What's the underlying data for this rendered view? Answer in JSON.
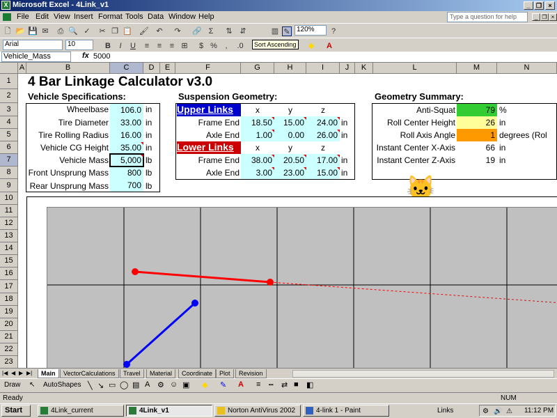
{
  "window": {
    "title": "Microsoft Excel - 4Link_v1"
  },
  "menu": [
    "File",
    "Edit",
    "View",
    "Insert",
    "Format",
    "Tools",
    "Data",
    "Window",
    "Help"
  ],
  "help_placeholder": "Type a question for help",
  "toolbar": {
    "zoom": "120%",
    "tooltip": "Sort Ascending",
    "font_name": "Arial",
    "font_size": "10"
  },
  "formula_bar": {
    "name_box": "Vehicle_Mass",
    "fx": "fx",
    "content": "5000"
  },
  "columns": [
    "A",
    "B",
    "C",
    "D",
    "E",
    "F",
    "G",
    "H",
    "I",
    "J",
    "K",
    "L",
    "M",
    "N"
  ],
  "rows": [
    "1",
    "2",
    "3",
    "4",
    "5",
    "6",
    "7",
    "8",
    "9",
    "10",
    "11",
    "12",
    "13",
    "14",
    "15",
    "16",
    "17",
    "18",
    "19",
    "20",
    "21",
    "22",
    "23"
  ],
  "sheet": {
    "title": "4 Bar Linkage Calculator v3.0",
    "vehicle": {
      "heading": "Vehicle Specifications:",
      "rows": [
        {
          "label": "Wheelbase",
          "value": "106.0",
          "unit": "in"
        },
        {
          "label": "Tire Diameter",
          "value": "33.00",
          "unit": "in"
        },
        {
          "label": "Tire Rolling Radius",
          "value": "16.00",
          "unit": "in"
        },
        {
          "label": "Vehicle CG Height",
          "value": "35.00",
          "unit": "in"
        },
        {
          "label": "Vehicle Mass",
          "value": "5,000",
          "unit": "lb"
        },
        {
          "label": "Front Unsprung Mass",
          "value": "800",
          "unit": "lb"
        },
        {
          "label": "Rear Unsprung Mass",
          "value": "700",
          "unit": "lb"
        }
      ]
    },
    "suspension": {
      "heading": "Suspension Geometry:",
      "cols": [
        "x",
        "y",
        "z"
      ],
      "upper": {
        "title": "Upper Links",
        "color": "#0000cc",
        "rows": [
          {
            "label": "Frame End",
            "x": "18.50",
            "y": "15.00",
            "z": "24.00",
            "unit": "in"
          },
          {
            "label": "Axle End",
            "x": "1.00",
            "y": "0.00",
            "z": "26.00",
            "unit": "in"
          }
        ]
      },
      "lower": {
        "title": "Lower Links",
        "color": "#cc0000",
        "rows": [
          {
            "label": "Frame End",
            "x": "38.00",
            "y": "20.50",
            "z": "17.00",
            "unit": "in"
          },
          {
            "label": "Axle End",
            "x": "3.00",
            "y": "23.00",
            "z": "15.00",
            "unit": "in"
          }
        ]
      }
    },
    "summary": {
      "heading": "Geometry Summary:",
      "rows": [
        {
          "label": "Anti-Squat",
          "value": "79",
          "unit": "%",
          "color": "#33cc33"
        },
        {
          "label": "Roll Center Height",
          "value": "26",
          "unit": "in",
          "color": "#ffff99"
        },
        {
          "label": "Roll Axis Angle",
          "value": "1",
          "unit": "degrees (Rol",
          "color": "#ff9900"
        },
        {
          "label": "Instant Center X-Axis",
          "value": "66",
          "unit": "in",
          "color": "#ffffff"
        },
        {
          "label": "Instant Center Z-Axis",
          "value": "19",
          "unit": "in",
          "color": "#ffffff"
        }
      ]
    }
  },
  "colors": {
    "upper_link": "#0000ff",
    "lower_link": "#ff0000",
    "plot_bg": "#c0c0c0",
    "input_cell": "#ccffff"
  },
  "tabs": [
    "Main",
    "VectorCalculations",
    "Travel",
    "Material",
    "Coordinate",
    "Plot",
    "Revision"
  ],
  "active_tab": "Main",
  "drawing_toolbar": {
    "draw": "Draw",
    "autoshapes": "AutoShapes"
  },
  "status": {
    "left": "Ready",
    "num": "NUM"
  },
  "taskbar": {
    "start": "Start",
    "tasks": [
      "4Link_current",
      "4Link_v1",
      "Norton AntiVirus 2002",
      "4-link 1 - Paint"
    ],
    "links": "Links",
    "time": "11:12 PM"
  }
}
